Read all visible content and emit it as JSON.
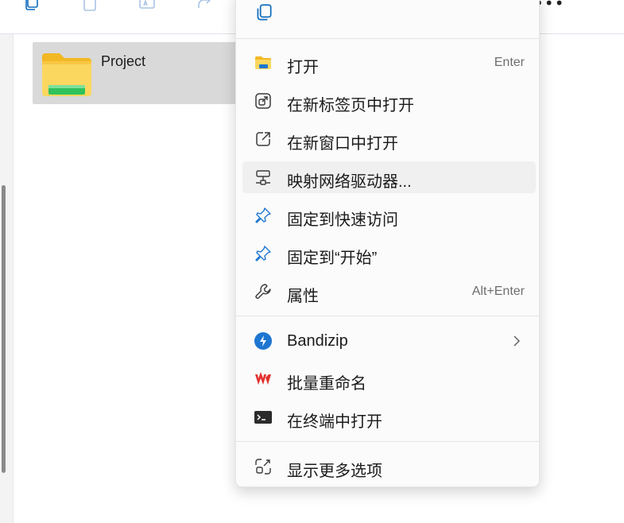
{
  "explorer": {
    "folder_name": "Project"
  },
  "context_menu": {
    "items": [
      {
        "label": "打开",
        "shortcut": "Enter",
        "icon": "folder-icon"
      },
      {
        "label": "在新标签页中打开",
        "shortcut": "",
        "icon": "open-new-tab-icon"
      },
      {
        "label": "在新窗口中打开",
        "shortcut": "",
        "icon": "open-new-window-icon"
      },
      {
        "label": "映射网络驱动器...",
        "shortcut": "",
        "icon": "network-drive-icon"
      },
      {
        "label": "固定到快速访问",
        "shortcut": "",
        "icon": "pin-icon"
      },
      {
        "label": "固定到“开始”",
        "shortcut": "",
        "icon": "pin-icon"
      },
      {
        "label": "属性",
        "shortcut": "Alt+Enter",
        "icon": "wrench-icon"
      }
    ],
    "app_items": [
      {
        "label": "Bandizip",
        "icon": "bandizip-icon",
        "has_submenu": true
      },
      {
        "label": "批量重命名",
        "icon": "wps-icon"
      },
      {
        "label": "在终端中打开",
        "icon": "terminal-icon"
      }
    ],
    "more_label": "显示更多选项"
  },
  "colors": {
    "accent": "#0067c0",
    "selection": "#d9d9d9",
    "hover": "#f0f0f0",
    "folder_yellow": "#f7cd4b",
    "wps_red": "#e3322f"
  }
}
